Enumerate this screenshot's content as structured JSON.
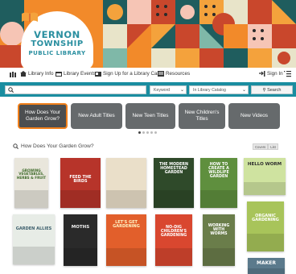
{
  "colors": {
    "accent": "#1a8da0",
    "banner_orange": "#f28a2a",
    "tile_bg": "#666a6c",
    "tile_active_border": "#f07f1a"
  },
  "logo": {
    "line1": "VERNON",
    "line2": "TOWNSHIP",
    "line3": "PUBLIC LIBRARY",
    "icon": "open-book-icon"
  },
  "nav": {
    "items": [
      {
        "label": "Library Info",
        "icon": "library-icon"
      },
      {
        "label": "Library Events",
        "icon": "calendar-icon"
      },
      {
        "label": "Sign Up for a Library Card",
        "icon": "card-icon"
      },
      {
        "label": "Resources",
        "icon": "resources-icon"
      }
    ],
    "sign_in": "Sign In",
    "sign_in_icon": "sign-in-icon",
    "menu_icon": "menu-icon"
  },
  "search": {
    "value": "",
    "type_select": "Keyword",
    "scope_select": "In Library Catalog",
    "button": "Search"
  },
  "carousel": {
    "tiles": [
      {
        "label": "How Does Your Garden Grow?",
        "active": true
      },
      {
        "label": "New Adult Titles",
        "active": false
      },
      {
        "label": "New Teen Titles",
        "active": false
      },
      {
        "label": "New Children's Titles",
        "active": false
      },
      {
        "label": "New Videos",
        "active": false
      }
    ],
    "dots": 5,
    "current": 0
  },
  "section": {
    "title": "How Does Your Garden Grow?",
    "view_options": [
      "Covers",
      "List"
    ]
  },
  "books": [
    {
      "title": "GROWING VEGETABLES, HERBS & FRUIT",
      "bg": "#e9e6dc",
      "fg": "#3f6b2a"
    },
    {
      "title": "FEED THE BIRDS",
      "bg": "#b7342a",
      "fg": "#ffffff"
    },
    {
      "title": "",
      "bg": "#eadfc9",
      "fg": "#7a5a2e"
    },
    {
      "title": "THE MODERN HOMESTEAD GARDEN",
      "bg": "#2f4a2a",
      "fg": "#ffffff"
    },
    {
      "title": "HOW TO CREATE A WILDLIFE GARDEN",
      "bg": "#5f8f3e",
      "fg": "#ffffff"
    },
    {
      "title": "HELLO WORM",
      "bg": "#cfe3a0",
      "fg": "#2d2d2d"
    },
    {
      "title": "GARDEN ALLIES",
      "bg": "#e7ece6",
      "fg": "#3b5d6b"
    },
    {
      "title": "MOTHS",
      "bg": "#2a2a2a",
      "fg": "#f2f2f2"
    },
    {
      "title": "LET'S GET GARDENING",
      "bg": "#e25f2b",
      "fg": "#fff3c4"
    },
    {
      "title": "NO-DIG CHILDREN'S GARDENING",
      "bg": "#d9472f",
      "fg": "#ffffff"
    },
    {
      "title": "WORKING WITH WORMS",
      "bg": "#6a7d4a",
      "fg": "#ffffff"
    },
    {
      "title": "ORGANIC GARDENING",
      "bg": "#a8c45a",
      "fg": "#ffffff"
    },
    {
      "title": "MAKER",
      "bg": "#5b7a8c",
      "fg": "#ffffff"
    }
  ]
}
